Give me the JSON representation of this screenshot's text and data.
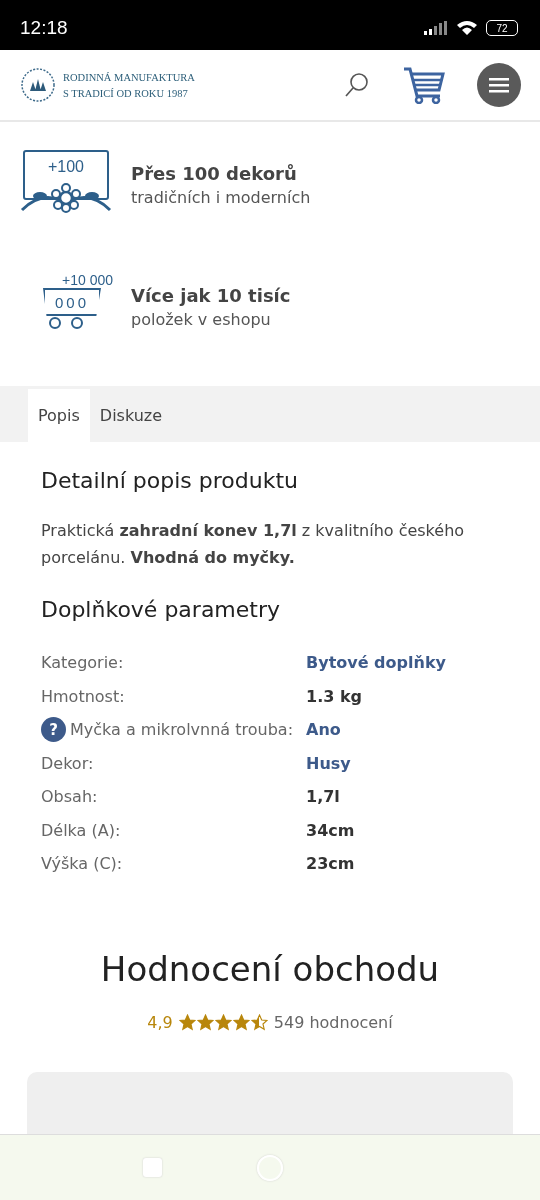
{
  "status_bar": {
    "time": "12:18",
    "battery": "72"
  },
  "header": {
    "brand_line_1": "RODINNÁ MANUFAKTURA",
    "brand_line_2": "S TRADICÍ OD ROKU 1987"
  },
  "features": [
    {
      "kind": "decor",
      "badge": "+100",
      "title": "Přes 100 dekorů",
      "subtitle": "tradičních i moderních"
    },
    {
      "kind": "cart",
      "badge": "+10 000",
      "digits": "000",
      "title": "Více jak 10 tisíc",
      "subtitle": "položek v eshopu"
    }
  ],
  "tabs": [
    {
      "label": "Popis",
      "selected": true
    },
    {
      "label": "Diskuze",
      "selected": false
    }
  ],
  "description": {
    "heading": "Detailní popis produktu",
    "text": "Praktická **zahradní konev 1,7l** z kvalitního českého porcelánu. **Vhodná do myčky.**"
  },
  "parameters": {
    "heading": "Doplňkové parametry",
    "rows": [
      {
        "label": "Kategorie:",
        "value": "Bytové doplňky",
        "kind": "link",
        "help": false
      },
      {
        "label": "Hmotnost:",
        "value": "1.3 kg",
        "kind": "text",
        "help": false
      },
      {
        "label": "Myčka a mikrolvnná trouba:",
        "value": "Ano",
        "kind": "link",
        "help": true,
        "help_icon": "?"
      },
      {
        "label": "Dekor:",
        "value": "Husy",
        "kind": "link",
        "help": false
      },
      {
        "label": "Obsah:",
        "value": "1,7l",
        "kind": "text",
        "help": false
      },
      {
        "label": "Délka (A):",
        "value": "34cm",
        "kind": "text",
        "help": false
      },
      {
        "label": "Výška (C):",
        "value": "23cm",
        "kind": "text",
        "help": false
      }
    ]
  },
  "rating": {
    "heading": "Hodnocení obchodu",
    "score": "4,9",
    "stars": 4.5,
    "count": "549 hodnocení"
  }
}
